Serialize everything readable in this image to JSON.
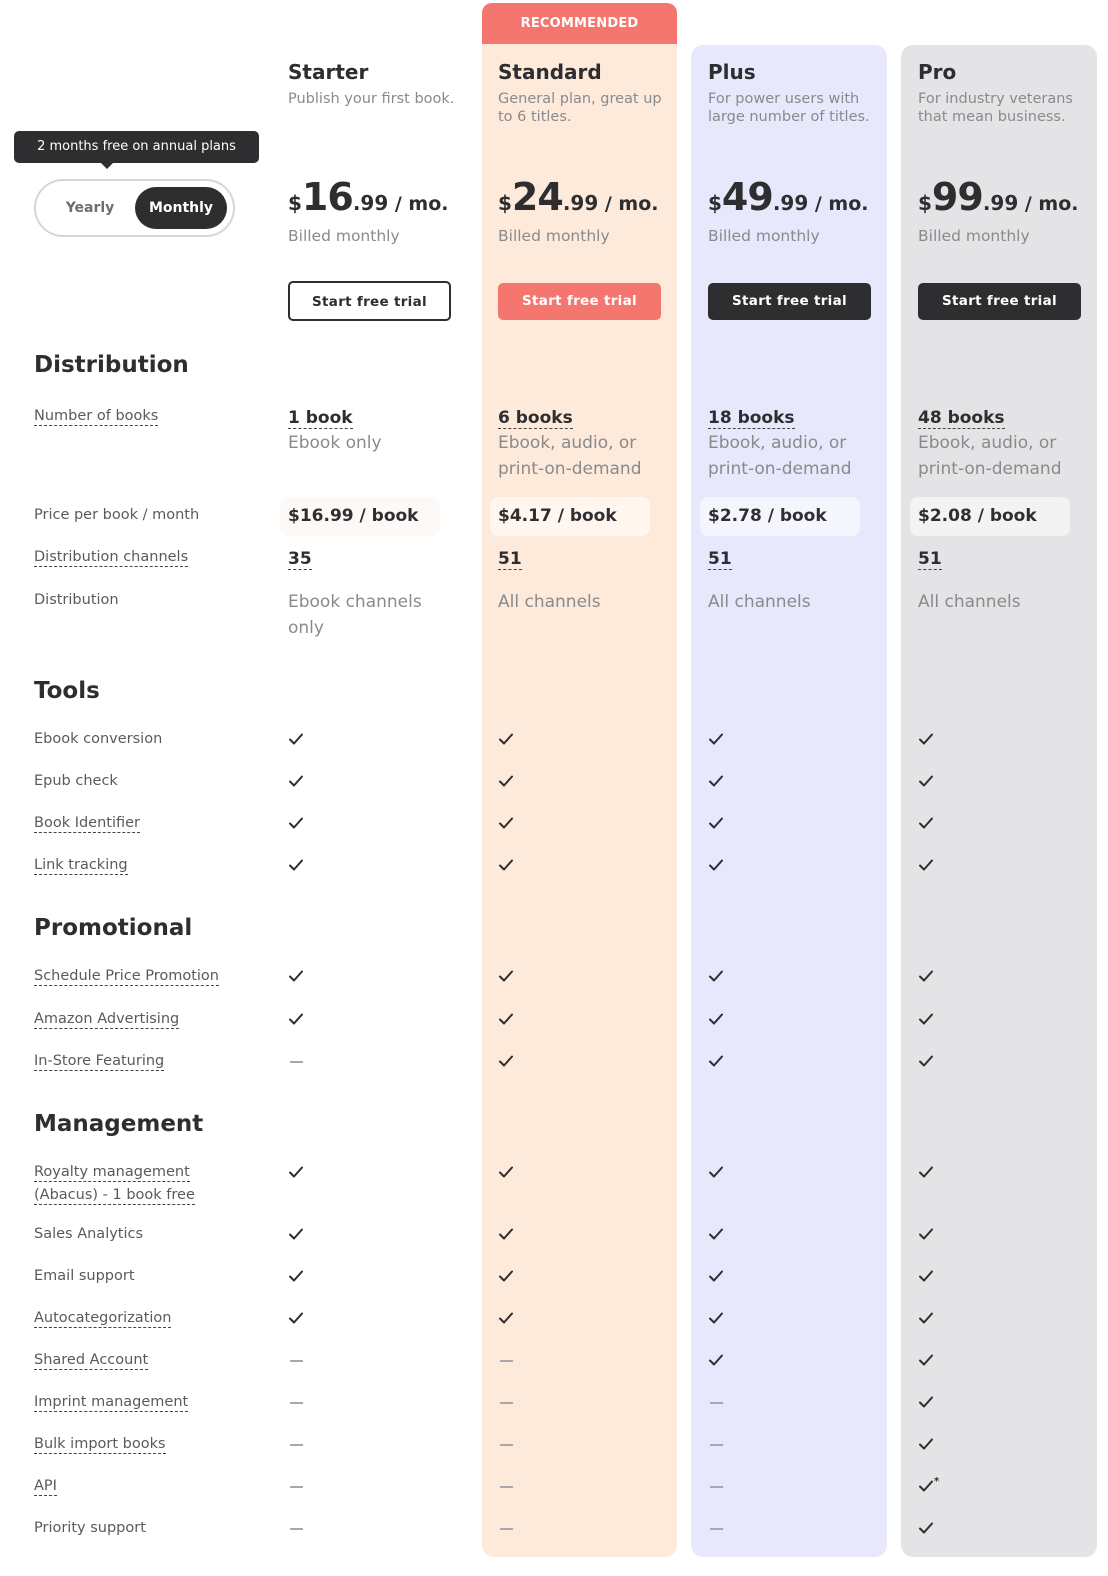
{
  "billing": {
    "tooltip": "2 months free on annual plans",
    "options": [
      "Yearly",
      "Monthly"
    ],
    "selected": "Monthly"
  },
  "recommended_label": "RECOMMENDED",
  "colors": {
    "coral": "#f4766f",
    "standard_bg": "#fdeadb",
    "plus_bg": "#e7e8fb",
    "pro_bg": "#e4e4e6",
    "dark": "#2e2e30"
  },
  "plans": [
    {
      "name": "Starter",
      "description": "Publish your first book.",
      "currency": "$",
      "price_whole": "16",
      "price_cents": ".99",
      "per": " / mo.",
      "billed": "Billed monthly",
      "cta": "Start free trial",
      "books": "1 book",
      "formats": "Ebook only",
      "price_per_book": "$16.99 / book",
      "channels": "35",
      "distribution": "Ebook channels only"
    },
    {
      "name": "Standard",
      "description": "General plan, great up to 6 titles.",
      "currency": "$",
      "price_whole": "24",
      "price_cents": ".99",
      "per": " / mo.",
      "billed": "Billed monthly",
      "cta": "Start free trial",
      "books": "6 books",
      "formats": "Ebook, audio, or print-on-demand",
      "price_per_book": "$4.17 / book",
      "channels": "51",
      "distribution": "All channels"
    },
    {
      "name": "Plus",
      "description": "For power users with large number of titles.",
      "currency": "$",
      "price_whole": "49",
      "price_cents": ".99",
      "per": " / mo.",
      "billed": "Billed monthly",
      "cta": "Start free trial",
      "books": "18 books",
      "formats": "Ebook, audio, or print-on-demand",
      "price_per_book": "$2.78 / book",
      "channels": "51",
      "distribution": "All channels"
    },
    {
      "name": "Pro",
      "description": "For industry veterans that mean business.",
      "currency": "$",
      "price_whole": "99",
      "price_cents": ".99",
      "per": " / mo.",
      "billed": "Billed monthly",
      "cta": "Start free trial",
      "books": "48 books",
      "formats": "Ebook, audio, or print-on-demand",
      "price_per_book": "$2.08 / book",
      "channels": "51",
      "distribution": "All channels"
    }
  ],
  "distribution": {
    "title": "Distribution",
    "rows": {
      "books": "Number of books",
      "price_per_book": "Price per book / month",
      "channels": "Distribution channels",
      "distribution": "Distribution"
    }
  },
  "features": [
    {
      "title": "Tools",
      "rows": [
        {
          "label": "Ebook conversion",
          "dashed": false,
          "values": [
            "check",
            "check",
            "check",
            "check"
          ]
        },
        {
          "label": "Epub check",
          "dashed": false,
          "values": [
            "check",
            "check",
            "check",
            "check"
          ]
        },
        {
          "label": "Book Identifier",
          "dashed": true,
          "values": [
            "check",
            "check",
            "check",
            "check"
          ]
        },
        {
          "label": "Link tracking",
          "dashed": true,
          "values": [
            "check",
            "check",
            "check",
            "check"
          ]
        }
      ]
    },
    {
      "title": "Promotional",
      "rows": [
        {
          "label": "Schedule Price Promotion",
          "dashed": true,
          "values": [
            "check",
            "check",
            "check",
            "check"
          ]
        },
        {
          "label": "Amazon Advertising",
          "dashed": true,
          "values": [
            "check",
            "check",
            "check",
            "check"
          ]
        },
        {
          "label": "In-Store Featuring",
          "dashed": true,
          "values": [
            "dash",
            "check",
            "check",
            "check"
          ]
        }
      ]
    },
    {
      "title": "Management",
      "rows": [
        {
          "label": "Royalty management",
          "label2": "(Abacus) - 1 book free",
          "dashed": true,
          "values": [
            "check",
            "check",
            "check",
            "check"
          ]
        },
        {
          "label": "Sales Analytics",
          "dashed": false,
          "values": [
            "check",
            "check",
            "check",
            "check"
          ]
        },
        {
          "label": "Email support",
          "dashed": false,
          "values": [
            "check",
            "check",
            "check",
            "check"
          ]
        },
        {
          "label": "Autocategorization",
          "dashed": true,
          "values": [
            "check",
            "check",
            "check",
            "check"
          ]
        },
        {
          "label": "Shared Account",
          "dashed": true,
          "values": [
            "dash",
            "dash",
            "check",
            "check"
          ]
        },
        {
          "label": "Imprint management",
          "dashed": true,
          "values": [
            "dash",
            "dash",
            "dash",
            "check"
          ]
        },
        {
          "label": "Bulk import books",
          "dashed": true,
          "values": [
            "dash",
            "dash",
            "dash",
            "check"
          ]
        },
        {
          "label": "API",
          "dashed": true,
          "values": [
            "dash",
            "dash",
            "dash",
            "check*"
          ]
        },
        {
          "label": "Priority support",
          "dashed": false,
          "values": [
            "dash",
            "dash",
            "dash",
            "check"
          ]
        }
      ]
    }
  ]
}
